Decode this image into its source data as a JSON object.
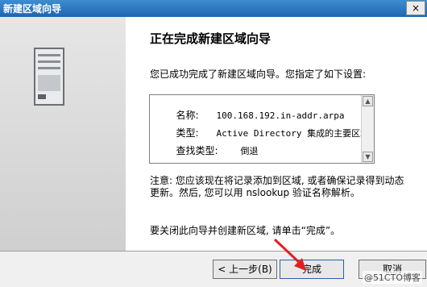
{
  "window": {
    "title": "新建区域向导",
    "close_label": "×"
  },
  "heading": "正在完成新建区域向导",
  "intro": "您已成功完成了新建区域向导。您指定了如下设置:",
  "summary": [
    {
      "label": "名称:",
      "value": "100.168.192.in-addr.arpa"
    },
    {
      "label": "类型:",
      "value": "Active Directory 集成的主要区域"
    },
    {
      "label": "查找类型:",
      "value": "倒退"
    }
  ],
  "note": "注意: 您应该现在将记录添加到区域, 或者确保记录得到动态更新。然后, 您可以用 nslookup 验证名称解析。",
  "closing": "要关闭此向导并创建新区域, 请单击“完成”。",
  "buttons": {
    "back": "< 上一步(B)",
    "finish": "完成",
    "cancel": "取消"
  },
  "watermark": "@51CTO博客",
  "colors": {
    "title_bar": "#1f64b0",
    "arrow": "#e02020"
  }
}
